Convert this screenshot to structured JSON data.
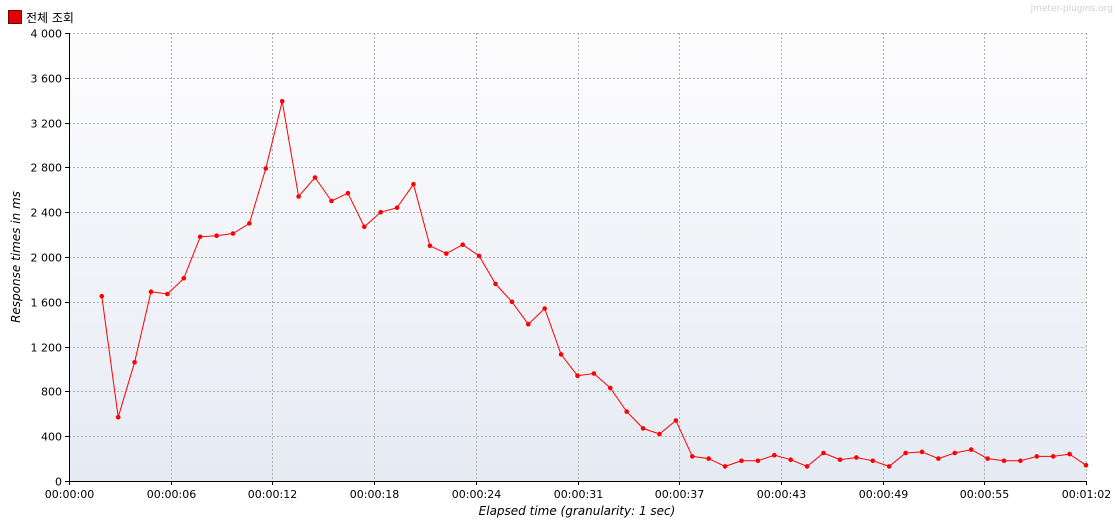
{
  "legend": {
    "label": "전체 조회",
    "color": "#ff0000"
  },
  "watermark": "jmeter-plugins.org",
  "chart_data": {
    "type": "line",
    "xlabel": "Elapsed time (granularity: 1 sec)",
    "ylabel": "Response times in ms",
    "ylim": [
      0,
      4000
    ],
    "xlim_seconds": [
      0,
      62
    ],
    "y_ticks": [
      {
        "value": 0,
        "label": "0"
      },
      {
        "value": 400,
        "label": "400"
      },
      {
        "value": 800,
        "label": "800"
      },
      {
        "value": 1200,
        "label": "1 200"
      },
      {
        "value": 1600,
        "label": "1 600"
      },
      {
        "value": 2000,
        "label": "2 000"
      },
      {
        "value": 2400,
        "label": "2 400"
      },
      {
        "value": 2800,
        "label": "2 800"
      },
      {
        "value": 3200,
        "label": "3 200"
      },
      {
        "value": 3600,
        "label": "3 600"
      },
      {
        "value": 4000,
        "label": "4 000"
      }
    ],
    "x_ticks": [
      {
        "value": 0,
        "label": "00:00:00"
      },
      {
        "value": 6.2,
        "label": "00:00:06"
      },
      {
        "value": 12.4,
        "label": "00:00:12"
      },
      {
        "value": 18.6,
        "label": "00:00:18"
      },
      {
        "value": 24.8,
        "label": "00:00:24"
      },
      {
        "value": 31,
        "label": "00:00:31"
      },
      {
        "value": 37.2,
        "label": "00:00:37"
      },
      {
        "value": 43.4,
        "label": "00:00:43"
      },
      {
        "value": 49.6,
        "label": "00:00:49"
      },
      {
        "value": 55.8,
        "label": "00:00:55"
      },
      {
        "value": 62,
        "label": "00:01:02"
      }
    ],
    "grid": true,
    "series": [
      {
        "name": "전체 조회",
        "color": "#ff0000",
        "x": [
          2,
          3,
          4,
          5,
          6,
          7,
          8,
          9,
          10,
          11,
          12,
          13,
          14,
          15,
          16,
          17,
          18,
          19,
          20,
          21,
          22,
          23,
          24,
          25,
          26,
          27,
          28,
          29,
          30,
          31,
          32,
          33,
          34,
          35,
          36,
          37,
          38,
          39,
          40,
          41,
          42,
          43,
          44,
          45,
          46,
          47,
          48,
          49,
          50,
          51,
          52,
          53,
          54,
          55,
          56,
          57,
          58,
          59,
          60,
          61,
          62
        ],
        "y": [
          1650,
          570,
          1060,
          1690,
          1670,
          1810,
          2180,
          2190,
          2210,
          2300,
          2790,
          3390,
          2540,
          2710,
          2500,
          2570,
          2270,
          2400,
          2440,
          2650,
          2100,
          2030,
          2110,
          2010,
          1760,
          1600,
          1400,
          1540,
          1130,
          940,
          960,
          830,
          620,
          470,
          420,
          540,
          220,
          200,
          130,
          180,
          180,
          230,
          190,
          130,
          250,
          190,
          210,
          180,
          130,
          250,
          260,
          200,
          250,
          280,
          200,
          180,
          180,
          220,
          220,
          240,
          140
        ]
      }
    ]
  }
}
